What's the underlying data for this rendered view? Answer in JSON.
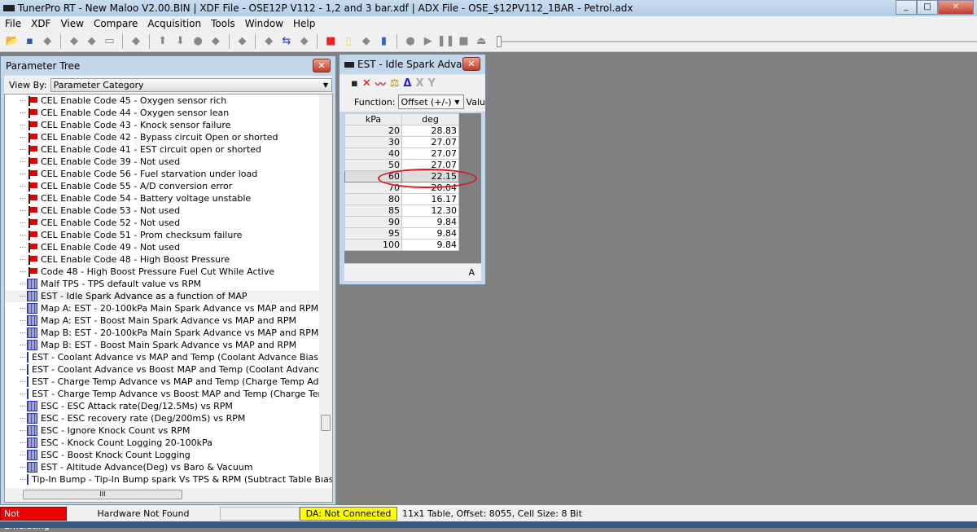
{
  "app": {
    "title": "TunerPro RT - New Maloo V2.00.BIN | XDF File - OSE12P V112 - 1,2 and 3 bar.xdf | ADX File - OSE_$12PV112_1BAR - Petrol.adx"
  },
  "menu": [
    "File",
    "XDF",
    "View",
    "Compare",
    "Acquisition",
    "Tools",
    "Window",
    "Help"
  ],
  "toolbar_icons": [
    "open-icon",
    "save-icon",
    "save-as-icon",
    "import-icon",
    "export-icon",
    "new-icon",
    "emulator-icon",
    "up-icon",
    "down-icon",
    "record-icon",
    "copy-icon",
    "chip-icon",
    "settings-icon",
    "swap-icon",
    "compare-icon",
    "stop-icon",
    "notes-icon",
    "dashboard-icon",
    "chart-icon",
    "record-icon",
    "play-icon",
    "pause-icon",
    "stop-icon",
    "eject-icon"
  ],
  "parameter_tree": {
    "title": "Parameter Tree",
    "view_by_label": "View By:",
    "view_by_value": "Parameter Category",
    "items": [
      {
        "icon": "flag",
        "label": "CEL Enable Code 45 - Oxygen sensor rich"
      },
      {
        "icon": "flag",
        "label": "CEL Enable Code 44 - Oxygen sensor lean"
      },
      {
        "icon": "flag",
        "label": "CEL Enable Code 43 - Knock sensor failure"
      },
      {
        "icon": "flag",
        "label": "CEL Enable Code 42 - Bypass circuit Open or shorted"
      },
      {
        "icon": "flag",
        "label": "CEL Enable Code 41 - EST circuit open or shorted"
      },
      {
        "icon": "flag",
        "label": "CEL Enable Code 39 - Not used"
      },
      {
        "icon": "flag",
        "label": "CEL Enable Code 56 - Fuel starvation under load"
      },
      {
        "icon": "flag",
        "label": "CEL Enable Code 55 - A/D conversion error"
      },
      {
        "icon": "flag",
        "label": "CEL Enable Code 54 - Battery voltage unstable"
      },
      {
        "icon": "flag",
        "label": "CEL Enable Code 53 - Not used"
      },
      {
        "icon": "flag",
        "label": "CEL Enable Code 52 - Not used"
      },
      {
        "icon": "flag",
        "label": "CEL Enable Code 51 - Prom checksum failure"
      },
      {
        "icon": "flag",
        "label": "CEL Enable Code 49 - Not used"
      },
      {
        "icon": "flag",
        "label": "CEL Enable Code 48 - High Boost Pressure"
      },
      {
        "icon": "flag",
        "label": "Code 48 - High Boost Pressure Fuel Cut While Active"
      },
      {
        "icon": "table",
        "label": "Malf TPS - TPS default value vs RPM"
      },
      {
        "icon": "table",
        "label": "EST - Idle Spark Advance as a function of MAP",
        "selected": true
      },
      {
        "icon": "table",
        "label": "Map A: EST - 20-100kPa Main Spark Advance vs MAP and RPM"
      },
      {
        "icon": "table",
        "label": "Map A: EST - Boost Main Spark Advance vs MAP and RPM"
      },
      {
        "icon": "table",
        "label": "Map B: EST - 20-100kPa Main Spark Advance vs MAP and RPM"
      },
      {
        "icon": "table",
        "label": "Map B: EST - Boost Main Spark Advance vs MAP and RPM"
      },
      {
        "icon": "table",
        "label": "EST - Coolant Advance vs MAP and Temp (Coolant Advance Bias Term Is Sub"
      },
      {
        "icon": "table",
        "label": "EST - Coolant Advance vs Boost MAP and Temp (Coolant Advance Bias Term"
      },
      {
        "icon": "table",
        "label": "EST - Charge Temp Advance vs MAP and Temp (Charge Temp Advance Bias T"
      },
      {
        "icon": "table",
        "label": "EST - Charge Temp Advance vs Boost MAP and Temp (Charge Temp Advance"
      },
      {
        "icon": "table",
        "label": "ESC - ESC Attack rate(Deg/12.5Ms) vs RPM"
      },
      {
        "icon": "table",
        "label": "ESC - ESC recovery rate (Deg/200mS) vs RPM"
      },
      {
        "icon": "table",
        "label": "ESC - Ignore Knock Count vs RPM"
      },
      {
        "icon": "table",
        "label": "ESC - Knock Count Logging 20-100kPa"
      },
      {
        "icon": "table",
        "label": "ESC - Boost Knock Count Logging"
      },
      {
        "icon": "table",
        "label": "EST - Altitude Advance(Deg) vs Baro & Vacuum"
      },
      {
        "icon": "table",
        "label": "Tip-In Bump - Tip-In Bump spark Vs TPS & RPM  (Subtract Table Bias)"
      }
    ]
  },
  "table_window": {
    "title": "EST - Idle Spark Adva...",
    "function_label": "Function:",
    "function_value": "Offset (+/-)",
    "value_label": "Valu",
    "col_headers": [
      "kPa",
      "deg"
    ],
    "rows": [
      [
        "20",
        "28.83"
      ],
      [
        "30",
        "27.07"
      ],
      [
        "40",
        "27.07"
      ],
      [
        "50",
        "27.07"
      ],
      [
        "60",
        "22.15"
      ],
      [
        "70",
        "20.04"
      ],
      [
        "80",
        "16.17"
      ],
      [
        "85",
        "12.30"
      ],
      [
        "90",
        "9.84"
      ],
      [
        "95",
        "9.84"
      ],
      [
        "100",
        "9.84"
      ]
    ],
    "selected_row": 4,
    "status": "A",
    "highlight_color": "#d81a24"
  },
  "status": {
    "emulation": "Not Emulating",
    "hardware": "Hardware Not Found",
    "da": "DA: Not Connected",
    "info": "11x1 Table, Offset: 8055,  Cell Size: 8 Bit"
  }
}
